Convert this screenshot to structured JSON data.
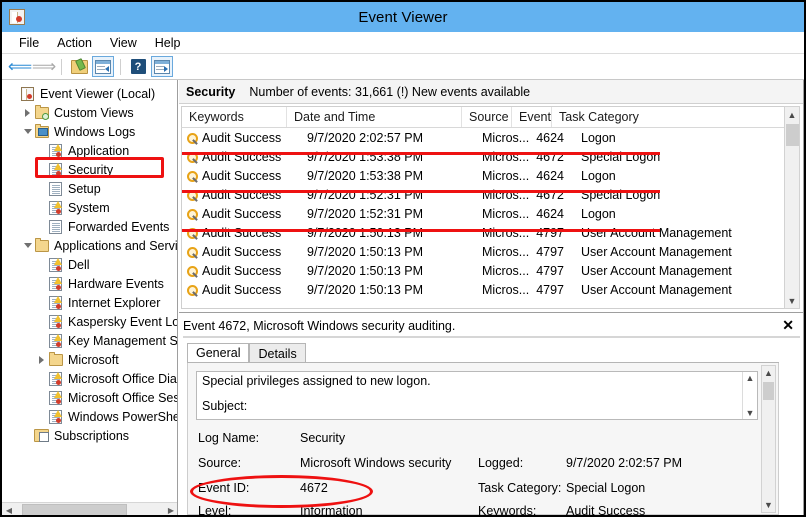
{
  "window": {
    "title": "Event Viewer",
    "icon": "event-viewer-icon"
  },
  "menu": [
    {
      "label": "File"
    },
    {
      "label": "Action"
    },
    {
      "label": "View"
    },
    {
      "label": "Help"
    }
  ],
  "toolbar": [
    {
      "name": "back-icon",
      "glyph": "←"
    },
    {
      "name": "forward-icon",
      "glyph": "→"
    },
    {
      "name": "open-saved-log-icon",
      "glyph": ""
    },
    {
      "name": "show-hide-console-tree-icon",
      "glyph": ""
    },
    {
      "name": "help-icon",
      "glyph": "?"
    },
    {
      "name": "show-hide-action-pane-icon",
      "glyph": ""
    }
  ],
  "tree": {
    "items": [
      {
        "label": "Event Viewer (Local)",
        "indent": 0,
        "expander": "none",
        "icon": "event-viewer-icon",
        "selected": false
      },
      {
        "label": "Custom Views",
        "indent": 1,
        "expander": "closed",
        "icon": "custom-views-icon",
        "selected": false
      },
      {
        "label": "Windows Logs",
        "indent": 1,
        "expander": "open",
        "icon": "windows-logs-icon",
        "selected": false
      },
      {
        "label": "Application",
        "indent": 2,
        "expander": "none",
        "icon": "log-icon",
        "selected": false
      },
      {
        "label": "Security",
        "indent": 2,
        "expander": "none",
        "icon": "log-icon",
        "selected": true
      },
      {
        "label": "Setup",
        "indent": 2,
        "expander": "none",
        "icon": "log-plain-icon",
        "selected": false
      },
      {
        "label": "System",
        "indent": 2,
        "expander": "none",
        "icon": "log-icon",
        "selected": false
      },
      {
        "label": "Forwarded Events",
        "indent": 2,
        "expander": "none",
        "icon": "log-plain-icon",
        "selected": false
      },
      {
        "label": "Applications and Servic",
        "indent": 1,
        "expander": "open",
        "icon": "folder-icon",
        "selected": false
      },
      {
        "label": "Dell",
        "indent": 2,
        "expander": "none",
        "icon": "log-icon",
        "selected": false
      },
      {
        "label": "Hardware Events",
        "indent": 2,
        "expander": "none",
        "icon": "log-icon",
        "selected": false
      },
      {
        "label": "Internet Explorer",
        "indent": 2,
        "expander": "none",
        "icon": "log-icon",
        "selected": false
      },
      {
        "label": "Kaspersky Event Log",
        "indent": 2,
        "expander": "none",
        "icon": "log-icon",
        "selected": false
      },
      {
        "label": "Key Management S",
        "indent": 2,
        "expander": "none",
        "icon": "log-icon",
        "selected": false
      },
      {
        "label": "Microsoft",
        "indent": 2,
        "expander": "closed",
        "icon": "folder-icon",
        "selected": false
      },
      {
        "label": "Microsoft Office Dia",
        "indent": 2,
        "expander": "none",
        "icon": "log-icon",
        "selected": false
      },
      {
        "label": "Microsoft Office Ses",
        "indent": 2,
        "expander": "none",
        "icon": "log-icon",
        "selected": false
      },
      {
        "label": "Windows PowerShe",
        "indent": 2,
        "expander": "none",
        "icon": "log-icon",
        "selected": false
      },
      {
        "label": "Subscriptions",
        "indent": 1,
        "expander": "none",
        "icon": "subscriptions-icon",
        "selected": false
      }
    ]
  },
  "list": {
    "banner_title": "Security",
    "banner_status": "Number of events: 31,661 (!) New events available",
    "columns": [
      {
        "label": "Keywords"
      },
      {
        "label": "Date and Time"
      },
      {
        "label": "Source"
      },
      {
        "label": "Event..."
      },
      {
        "label": "Task Category"
      }
    ],
    "rows": [
      {
        "keywords": "Audit Success",
        "datetime": "9/7/2020 2:02:57 PM",
        "source": "Micros...",
        "event_id": "4624",
        "task_category": "Logon"
      },
      {
        "keywords": "Audit Success",
        "datetime": "9/7/2020 1:53:38 PM",
        "source": "Micros...",
        "event_id": "4672",
        "task_category": "Special Logon"
      },
      {
        "keywords": "Audit Success",
        "datetime": "9/7/2020 1:53:38 PM",
        "source": "Micros...",
        "event_id": "4624",
        "task_category": "Logon"
      },
      {
        "keywords": "Audit Success",
        "datetime": "9/7/2020 1:52:31 PM",
        "source": "Micros...",
        "event_id": "4672",
        "task_category": "Special Logon"
      },
      {
        "keywords": "Audit Success",
        "datetime": "9/7/2020 1:52:31 PM",
        "source": "Micros...",
        "event_id": "4624",
        "task_category": "Logon"
      },
      {
        "keywords": "Audit Success",
        "datetime": "9/7/2020 1:50:13 PM",
        "source": "Micros...",
        "event_id": "4797",
        "task_category": "User Account Management"
      },
      {
        "keywords": "Audit Success",
        "datetime": "9/7/2020 1:50:13 PM",
        "source": "Micros...",
        "event_id": "4797",
        "task_category": "User Account Management"
      },
      {
        "keywords": "Audit Success",
        "datetime": "9/7/2020 1:50:13 PM",
        "source": "Micros...",
        "event_id": "4797",
        "task_category": "User Account Management"
      },
      {
        "keywords": "Audit Success",
        "datetime": "9/7/2020 1:50:13 PM",
        "source": "Micros...",
        "event_id": "4797",
        "task_category": "User Account Management"
      }
    ]
  },
  "detail": {
    "header": "Event 4672, Microsoft Windows security auditing.",
    "close_label": "✕",
    "tabs": [
      {
        "label": "General",
        "active": true
      },
      {
        "label": "Details",
        "active": false
      }
    ],
    "message_line1": "Special privileges assigned to new logon.",
    "message_line2": "Subject:",
    "fields": [
      {
        "label": "Log Name:",
        "value": "Security"
      },
      {
        "label": "Source:",
        "value": "Microsoft Windows security"
      },
      {
        "label": "Event ID:",
        "value": "4672"
      },
      {
        "label": "Level:",
        "value": "Information"
      }
    ],
    "fields_right": [
      {
        "label": "Logged:",
        "value": "9/7/2020 2:02:57 PM"
      },
      {
        "label": "Task Category:",
        "value": "Special Logon"
      },
      {
        "label": "Keywords:",
        "value": "Audit Success"
      }
    ]
  },
  "annotations": {
    "highlight_color": "#ee1111",
    "security_box": "Security",
    "event_id_ellipse": "Event ID: 4672",
    "underlines": [
      "row-1-bottom",
      "row-3-bottom",
      "row-5-bottom"
    ]
  },
  "colors": {
    "titlebar": "#63b2f0",
    "annotation_red": "#ee1111",
    "banner_bg": "#f4f4f4"
  }
}
